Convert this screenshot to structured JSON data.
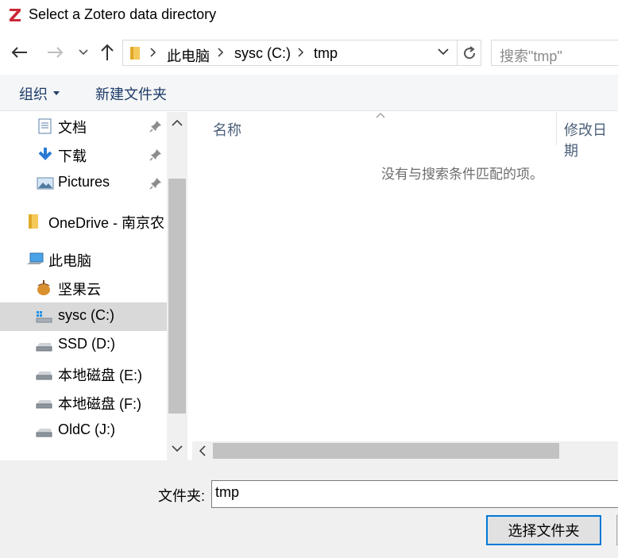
{
  "window": {
    "title": "Select a Zotero data directory",
    "accent_color": "#0078d7",
    "app_icon_color": "#cc2936"
  },
  "nav": {
    "back_icon": "arrow-left-icon",
    "forward_icon": "arrow-right-icon",
    "recent_icon": "chevron-down-icon",
    "up_icon": "arrow-up-icon"
  },
  "address": {
    "crumbs": [
      "此电脑",
      "sysc (C:)",
      "tmp"
    ]
  },
  "search": {
    "placeholder": "搜索\"tmp\""
  },
  "command_bar": {
    "organize": "组织",
    "new_folder": "新建文件夹"
  },
  "sidebar": {
    "items": [
      {
        "label": "文档",
        "icon": "document-icon",
        "pinned": true
      },
      {
        "label": "下载",
        "icon": "download-icon",
        "pinned": true
      },
      {
        "label": "Pictures",
        "icon": "pictures-icon",
        "pinned": true
      },
      {
        "label": "OneDrive - 南京农",
        "icon": "folder-icon",
        "pinned": false
      },
      {
        "label": "此电脑",
        "icon": "computer-icon",
        "pinned": false
      },
      {
        "label": "坚果云",
        "icon": "nutstore-icon",
        "pinned": false
      },
      {
        "label": "sysc (C:)",
        "icon": "system-drive-icon",
        "pinned": false,
        "selected": true
      },
      {
        "label": "SSD (D:)",
        "icon": "drive-icon",
        "pinned": false
      },
      {
        "label": "本地磁盘 (E:)",
        "icon": "drive-icon",
        "pinned": false
      },
      {
        "label": "本地磁盘 (F:)",
        "icon": "drive-icon",
        "pinned": false
      },
      {
        "label": "OldC (J:)",
        "icon": "drive-icon",
        "pinned": false
      }
    ]
  },
  "file_list": {
    "columns": [
      "名称",
      "修改日期"
    ],
    "empty_message": "没有与搜索条件匹配的项。"
  },
  "footer": {
    "folder_label": "文件夹:",
    "folder_value": "tmp",
    "select_button": "选择文件夹"
  }
}
